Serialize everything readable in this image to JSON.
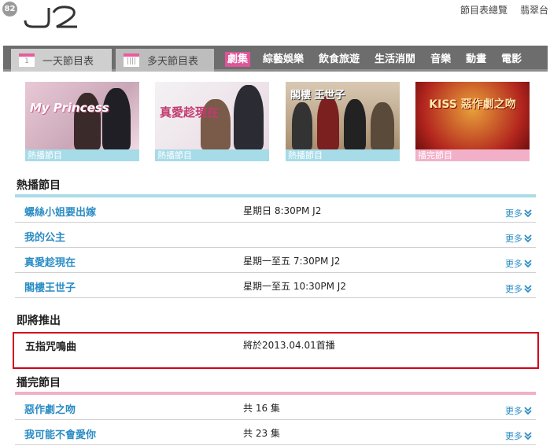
{
  "header": {
    "channel_badge": "82",
    "logo_text": "J2",
    "links": [
      "節目表總覽",
      "翡翠台"
    ]
  },
  "nav": {
    "day_tabs": [
      {
        "icon_label": "1",
        "label": "一天節目表"
      },
      {
        "icon_label": "||||",
        "label": "多天節目表"
      }
    ],
    "categories": [
      "劇集",
      "綜藝娛樂",
      "飲食旅遊",
      "生活消閒",
      "音樂",
      "動畫",
      "電影"
    ],
    "active_category": "劇集"
  },
  "tiles": [
    {
      "art_text": "My Princess",
      "caption": "熱播節目"
    },
    {
      "art_text": "真愛趁現在",
      "caption": "熱播節目"
    },
    {
      "art_text": "閣樓 王世子",
      "caption": "熱播節目"
    },
    {
      "art_text": "KISS 惡作劇之吻",
      "caption": "播完節目"
    }
  ],
  "sections": {
    "hot": {
      "title": "熱播節目",
      "rows": [
        {
          "name": "螺絲小姐要出嫁",
          "time": "星期日 8:30PM J2",
          "more": "更多"
        },
        {
          "name": "我的公主",
          "time": "",
          "more": "更多"
        },
        {
          "name": "真愛趁現在",
          "time": "星期一至五 7:30PM J2",
          "more": "更多"
        },
        {
          "name": "閣樓王世子",
          "time": "星期一至五 10:30PM J2",
          "more": "更多"
        }
      ]
    },
    "upcoming": {
      "title": "即將推出",
      "name": "五指咒鳴曲",
      "time": "將於2013.04.01首播"
    },
    "finished": {
      "title": "播完節目",
      "rows": [
        {
          "name": "惡作劇之吻",
          "time": "共 16 集",
          "more": "更多"
        },
        {
          "name": "我可能不會愛你",
          "time": "共 23 集",
          "more": "更多"
        }
      ]
    }
  },
  "colors": {
    "accent_pink": "#e0549a",
    "link_blue": "#2a8cc4",
    "hot_line": "#a8dce8",
    "finished_line": "#f0b0c8",
    "highlight_red": "#d0021b"
  }
}
